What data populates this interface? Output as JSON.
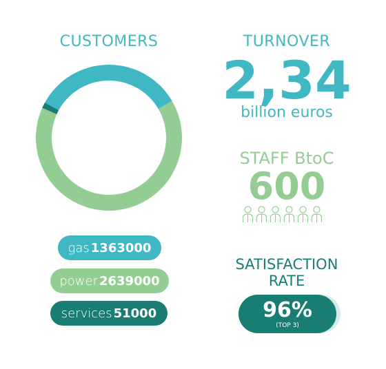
{
  "customers": {
    "title": "CUSTOMERS",
    "items": [
      {
        "label": "gas",
        "value": "1363000",
        "color": "#3fb8c4"
      },
      {
        "label": "power",
        "value": "2639000",
        "color": "#94cd94"
      },
      {
        "label": "services",
        "value": "51000",
        "color": "#1a7d74"
      }
    ]
  },
  "turnover": {
    "title": "TURNOVER",
    "value": "2,34",
    "unit": "billion euros"
  },
  "staff": {
    "title": "STAFF BtoC",
    "value": "600",
    "icons": [
      "person-icon",
      "person-icon",
      "person-icon",
      "person-icon",
      "person-icon",
      "person-icon"
    ]
  },
  "satisfaction": {
    "title_line1": "SATISFACTION",
    "title_line2": "RATE",
    "value": "96%",
    "note": "(TOP 3)"
  },
  "chart_data": {
    "type": "pie",
    "title": "CUSTOMERS",
    "categories": [
      "gas",
      "power",
      "services"
    ],
    "values": [
      1363000,
      2639000,
      51000
    ],
    "colors": [
      "#3fb8c4",
      "#94cd94",
      "#1a7d74"
    ],
    "donut": true
  }
}
